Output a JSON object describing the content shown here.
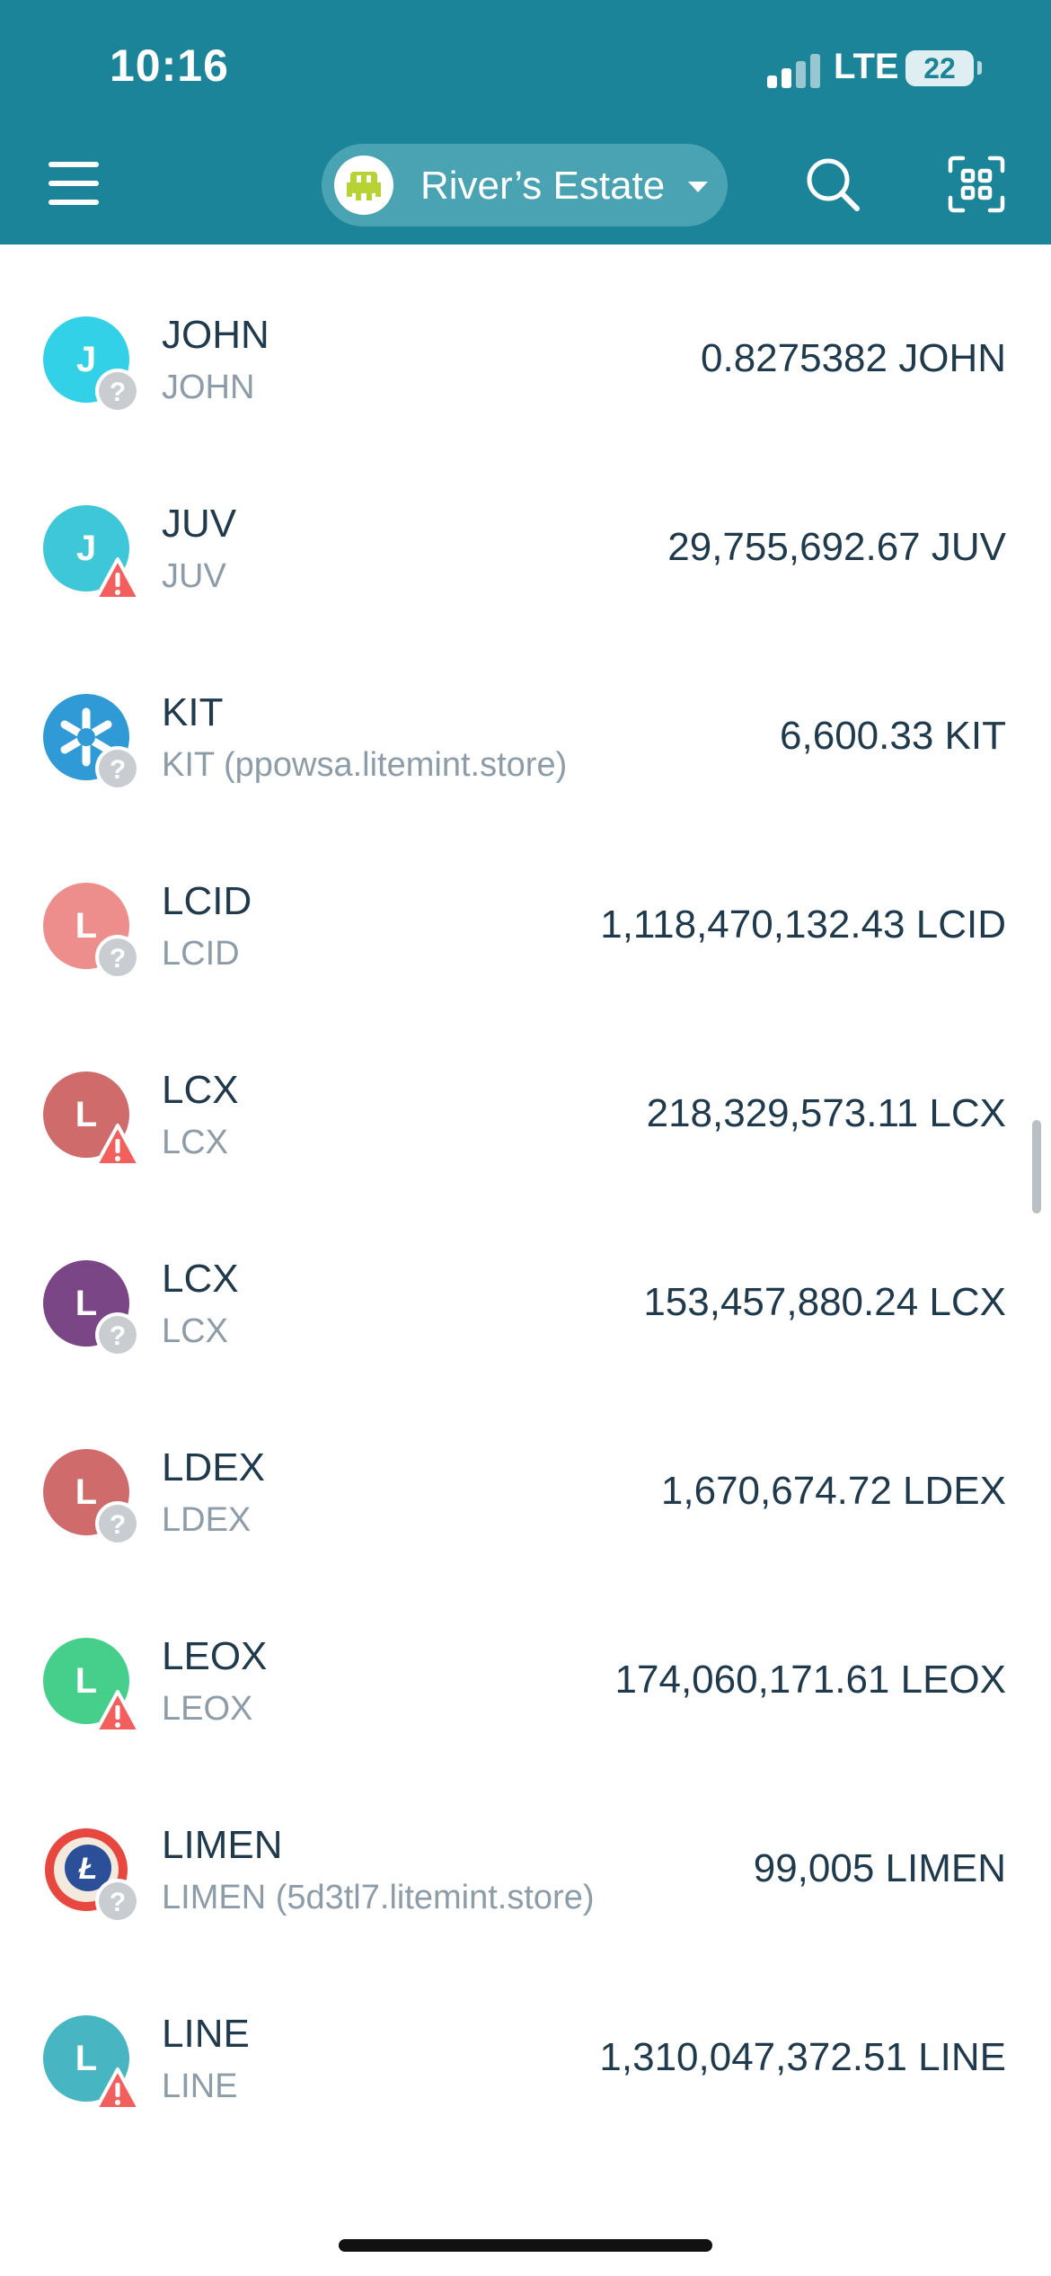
{
  "status_bar": {
    "time": "10:16",
    "network": "LTE",
    "battery": "22",
    "icons": [
      "signal-icon",
      "battery-icon"
    ]
  },
  "header": {
    "menu_icon": "hamburger-menu-icon",
    "wallet_name": "River’s Estate",
    "wallet_icon": "wallet-avatar-icon",
    "caret_icon": "chevron-down-icon",
    "search_icon": "search-icon",
    "scan_icon": "scan-qr-icon",
    "colors": {
      "bar": "#1b8499",
      "pill": "#4aa3b2",
      "avatar_accent": "#b6d235"
    }
  },
  "tokens": [
    {
      "letter": "J",
      "name": "JOHN",
      "subtitle": "JOHN",
      "balance": "0.8275382 JOHN",
      "color": "#33d1e8",
      "badge": "unknown"
    },
    {
      "letter": "J",
      "name": "JUV",
      "subtitle": "JUV",
      "balance": "29,755,692.67 JUV",
      "color": "#3ec7d8",
      "badge": "warning"
    },
    {
      "letter": "",
      "name": "KIT",
      "subtitle": "KIT (ppowsa.litemint.store)",
      "balance": "6,600.33 KIT",
      "color": "#2f9ad6",
      "badge": "unknown",
      "icon": "kit-logo-icon"
    },
    {
      "letter": "L",
      "name": "LCID",
      "subtitle": "LCID",
      "balance": "1,118,470,132.43 LCID",
      "color": "#ee8e8c",
      "badge": "unknown"
    },
    {
      "letter": "L",
      "name": "LCX",
      "subtitle": "LCX",
      "balance": "218,329,573.11 LCX",
      "color": "#cf6b6b",
      "badge": "warning"
    },
    {
      "letter": "L",
      "name": "LCX",
      "subtitle": "LCX",
      "balance": "153,457,880.24 LCX",
      "color": "#7a4685",
      "badge": "unknown"
    },
    {
      "letter": "L",
      "name": "LDEX",
      "subtitle": "LDEX",
      "balance": "1,670,674.72 LDEX",
      "color": "#cf6b6b",
      "badge": "unknown"
    },
    {
      "letter": "L",
      "name": "LEOX",
      "subtitle": "LEOX",
      "balance": "174,060,171.61 LEOX",
      "color": "#45cf8a",
      "badge": "warning"
    },
    {
      "letter": "",
      "name": "LIMEN",
      "subtitle": "LIMEN (5d3tl7.litemint.store)",
      "balance": "99,005 LIMEN",
      "color": "#e8473f",
      "badge": "unknown",
      "icon": "limen-logo-icon"
    },
    {
      "letter": "L",
      "name": "LINE",
      "subtitle": "LINE",
      "balance": "1,310,047,372.51 LINE",
      "color": "#48b6c2",
      "badge": "warning"
    }
  ],
  "badge_icons": {
    "unknown": "question-badge-icon",
    "warning": "warning-badge-icon"
  }
}
